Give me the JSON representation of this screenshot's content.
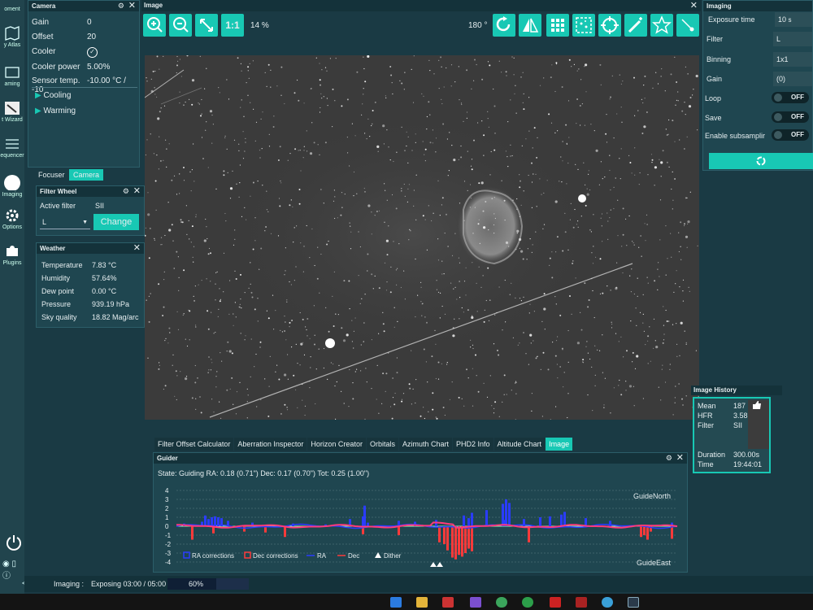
{
  "nav": {
    "items": [
      "oment",
      "y Atlas",
      "aming",
      "t Wizard",
      "equencer",
      "Imaging",
      "Options",
      "Plugins"
    ],
    "collapse": "<<"
  },
  "camera": {
    "title": "Camera",
    "rows": [
      {
        "k": "Gain",
        "v": "0"
      },
      {
        "k": "Offset",
        "v": "20"
      },
      {
        "k": "Cooler",
        "v": ""
      },
      {
        "k": "Cooler power",
        "v": "5.00%"
      },
      {
        "k": "Sensor temp.",
        "v": "-10.00 °C / -10"
      }
    ],
    "cooling": "Cooling",
    "warming": "Warming"
  },
  "subtabs": {
    "focuser": "Focuser",
    "camera": "Camera"
  },
  "filterwheel": {
    "title": "Filter Wheel",
    "active_label": "Active filter",
    "active_value": "SII",
    "select_value": "L",
    "change": "Change"
  },
  "weather": {
    "title": "Weather",
    "rows": [
      {
        "k": "Temperature",
        "v": "7.83 °C"
      },
      {
        "k": "Humidity",
        "v": "57.64%"
      },
      {
        "k": "Dew point",
        "v": "0.00 °C"
      },
      {
        "k": "Pressure",
        "v": "939.19 hPa"
      },
      {
        "k": "Sky quality",
        "v": "18.82 Mag/arc"
      }
    ]
  },
  "image": {
    "title": "Image",
    "one_to_one": "1:1",
    "zoom": "14 %",
    "rotation": "180 °"
  },
  "imaging": {
    "title": "Imaging",
    "exposure_label": "Exposure time",
    "exposure_value": "10",
    "exposure_unit": "s",
    "filter_label": "Filter",
    "filter_value": "L",
    "binning_label": "Binning",
    "binning_value": "1x1",
    "gain_label": "Gain",
    "gain_value": "(0)",
    "loop_label": "Loop",
    "save_label": "Save",
    "subsample_label": "Enable subsamplir",
    "off": "OFF"
  },
  "history": {
    "title": "Image History",
    "rows": [
      {
        "k": "Mean",
        "v": "187"
      },
      {
        "k": "HFR",
        "v": "3.58"
      },
      {
        "k": "Filter",
        "v": "SII"
      }
    ],
    "duration_label": "Duration",
    "duration_value": "300.00s",
    "time_label": "Time",
    "time_value": "19:44:01"
  },
  "tabs": [
    "Filter Offset Calculator",
    "Aberration Inspector",
    "Horizon Creator",
    "Orbitals",
    "Azimuth Chart",
    "PHD2 Info",
    "Altitude Chart",
    "Image"
  ],
  "guider": {
    "title": "Guider",
    "state": "State: Guiding  RA: 0.18 (0.71\")  Dec: 0.17 (0.70\")  Tot: 0.25 (1.00\")",
    "north": "GuideNorth",
    "east": "GuideEast",
    "legend": [
      "RA corrections",
      "Dec corrections",
      "RA",
      "Dec",
      "Dither"
    ]
  },
  "status": {
    "label": "Imaging :",
    "text": "Exposing 03:00 / 05:00",
    "progress_label": "60%",
    "progress": 0.6
  },
  "chart_data": {
    "type": "bar",
    "ylim": [
      -4,
      4
    ],
    "yticks": [
      "4",
      "3",
      "2",
      "1",
      "0",
      "-1",
      "-2",
      "-3",
      "-4"
    ],
    "ra_corrections": [
      0.3,
      0.5,
      1.2,
      0.8,
      1.0,
      1.1,
      1.0,
      0.9,
      0.6,
      0.4,
      0.3,
      0.2,
      0.8,
      1.1,
      2.3,
      0.4,
      0.6,
      0.5,
      0.7,
      1.2,
      0.9,
      1.5,
      1.8,
      0.7,
      2.5,
      3.0,
      2.6,
      0.8,
      1.0,
      1.1,
      1.3,
      1.6,
      0.9,
      0.6,
      0.4
    ],
    "dec_corrections": [
      -1.5,
      -0.8,
      -0.6,
      -0.7,
      -1.2,
      -0.9,
      -1.0,
      -1.8,
      -2.0,
      -2.7,
      -3.5,
      -3.7,
      -3.2,
      -3.4,
      -3.0,
      -2.5,
      -2.8,
      -1.8,
      -1.2,
      -1.0,
      -1.5,
      -0.6,
      -1.4,
      -1.6
    ]
  },
  "colors": {
    "accent": "#18c8b4",
    "ra": "#2a3cff",
    "dec": "#ff3a3a"
  }
}
